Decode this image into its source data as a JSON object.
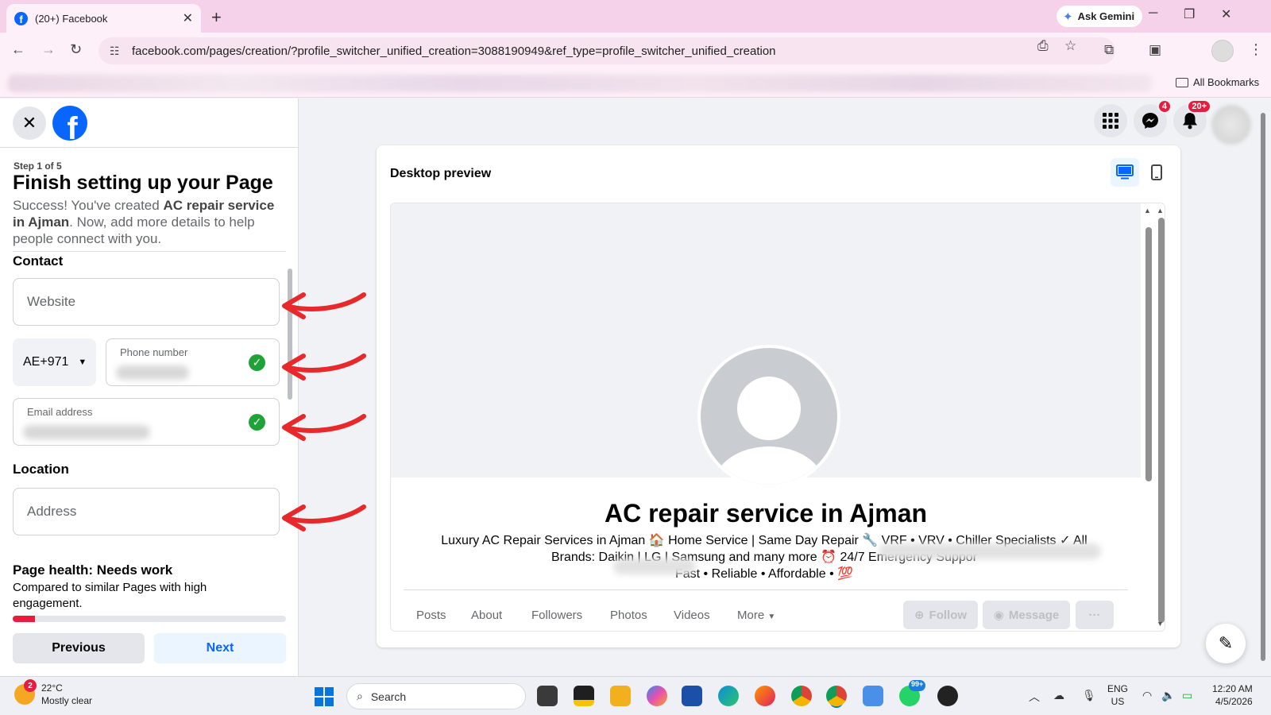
{
  "browser": {
    "tab_title": "(20+) Facebook",
    "ask_gemini": "Ask Gemini",
    "url": "facebook.com/pages/creation/?profile_switcher_unified_creation=3088190949&ref_type=profile_switcher_unified_creation",
    "all_bookmarks": "All Bookmarks"
  },
  "header": {
    "messenger_badge": "4",
    "notifications_badge": "20+"
  },
  "setup": {
    "step": "Step 1 of 5",
    "title": "Finish setting up your Page",
    "desc_prefix": "Success! You've created ",
    "desc_page_name": "AC repair service in Ajman",
    "desc_suffix": ". Now, add more details to help people connect with you.",
    "contact_label": "Contact",
    "website_placeholder": "Website",
    "country_code": "AE+971",
    "phone_label": "Phone number",
    "email_label": "Email address",
    "location_label": "Location",
    "address_placeholder": "Address",
    "health_title": "Page health: Needs work",
    "health_desc": "Compared to similar Pages with high engagement.",
    "health_progress": 0.08,
    "previous": "Previous",
    "next": "Next"
  },
  "preview": {
    "label": "Desktop preview",
    "page_name": "AC repair service in Ajman",
    "bio_line1": "Luxury AC Repair Services in Ajman 🏠 Home Service | Same Day Repair 🔧 VRF • VRV • Chiller Specialists ✓ All",
    "bio_line2": "Brands: Daikin | LG | Samsung and many more ⏰ 24/7 Emergency Suppor",
    "bio_line3": "Fast • Reliable • Affordable • 💯",
    "tabs": [
      "Posts",
      "About",
      "Followers",
      "Photos",
      "Videos",
      "More"
    ],
    "follow": "Follow",
    "message": "Message",
    "more_dots": "···"
  },
  "taskbar": {
    "weather_badge": "2",
    "temperature": "22°C",
    "weather_desc": "Mostly clear",
    "search": "Search",
    "whatsapp_badge": "99+",
    "lang1": "ENG",
    "lang2": "US",
    "time": "12:20 AM",
    "date": "4/5/2026"
  },
  "colors": {
    "facebook_blue": "#0866ff",
    "check_green": "#1fa339",
    "badge_red": "#e41e3f",
    "annotation_arrow": "#e8292b"
  }
}
